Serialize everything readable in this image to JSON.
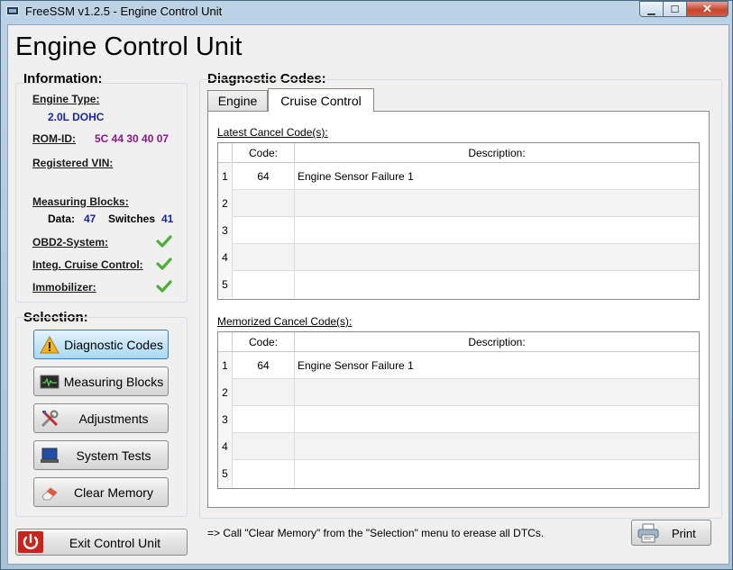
{
  "window": {
    "title": "FreeSSM v1.2.5 - Engine Control Unit",
    "controls": {
      "minimize": "▁",
      "maximize": "☐",
      "close": "✕"
    }
  },
  "page_title": "Engine Control Unit",
  "information": {
    "title": "Information:",
    "engine_type_label": "Engine Type:",
    "engine_type_value": "2.0L DOHC",
    "romid_label": "ROM-ID:",
    "romid_value": "5C 44 30 40 07",
    "vin_label": "Registered VIN:",
    "mb_label": "Measuring Blocks:",
    "mb_data_label": "Data:",
    "mb_data_value": "47",
    "mb_switches_label": "Switches",
    "mb_switches_value": "41",
    "obd2_label": "OBD2-System:",
    "cruise_label": "Integ. Cruise Control:",
    "immo_label": "Immobilizer:",
    "check_color": "#4caf3a"
  },
  "selection": {
    "title": "Selection:",
    "buttons": [
      {
        "label": "Diagnostic Codes",
        "icon": "warning-icon"
      },
      {
        "label": "Measuring Blocks",
        "icon": "monitor-graph-icon"
      },
      {
        "label": "Adjustments",
        "icon": "tools-icon"
      },
      {
        "label": "System Tests",
        "icon": "laptop-icon"
      },
      {
        "label": "Clear Memory",
        "icon": "eraser-icon"
      }
    ]
  },
  "diagnostic": {
    "title": "Diagnostic Codes:",
    "tabs": [
      {
        "label": "Engine"
      },
      {
        "label": "Cruise Control"
      }
    ],
    "latest": {
      "caption": "Latest Cancel Code(s):",
      "col_code": "Code:",
      "col_desc": "Description:",
      "rows": [
        {
          "idx": "1",
          "code": "64",
          "desc": "Engine Sensor Failure 1"
        },
        {
          "idx": "2",
          "code": "",
          "desc": ""
        },
        {
          "idx": "3",
          "code": "",
          "desc": ""
        },
        {
          "idx": "4",
          "code": "",
          "desc": ""
        },
        {
          "idx": "5",
          "code": "",
          "desc": ""
        }
      ]
    },
    "memorized": {
      "caption": "Memorized Cancel Code(s):",
      "col_code": "Code:",
      "col_desc": "Description:",
      "rows": [
        {
          "idx": "1",
          "code": "64",
          "desc": "Engine Sensor Failure 1"
        },
        {
          "idx": "2",
          "code": "",
          "desc": ""
        },
        {
          "idx": "3",
          "code": "",
          "desc": ""
        },
        {
          "idx": "4",
          "code": "",
          "desc": ""
        },
        {
          "idx": "5",
          "code": "",
          "desc": ""
        }
      ]
    }
  },
  "hint": "=> Call \"Clear Memory\" from the \"Selection\" menu to erease all DTCs.",
  "print_label": "Print",
  "exit_label": "Exit Control Unit"
}
